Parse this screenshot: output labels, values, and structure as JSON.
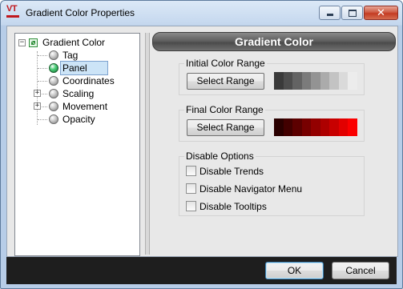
{
  "window": {
    "title": "Gradient Color Properties",
    "logo_text": "VT"
  },
  "tree": {
    "root": "Gradient Color",
    "items": [
      {
        "label": "Tag"
      },
      {
        "label": "Panel",
        "selected": true
      },
      {
        "label": "Coordinates"
      },
      {
        "label": "Scaling",
        "expandable": true
      },
      {
        "label": "Movement",
        "expandable": true
      },
      {
        "label": "Opacity"
      }
    ]
  },
  "header": {
    "title": "Gradient Color"
  },
  "initial_range": {
    "title": "Initial Color Range",
    "button": "Select Range",
    "colors": [
      "#3a3a3a",
      "#4d4d4d",
      "#636363",
      "#7b7b7b",
      "#939393",
      "#ababab",
      "#c3c3c3",
      "#dadada",
      "#ececec"
    ]
  },
  "final_range": {
    "title": "Final Color Range",
    "button": "Select Range",
    "colors": [
      "#2a0000",
      "#420000",
      "#5c0000",
      "#770000",
      "#930000",
      "#ad0000",
      "#c80000",
      "#e20000",
      "#fb0000"
    ]
  },
  "disable_options": {
    "title": "Disable Options",
    "items": [
      {
        "label": "Disable Trends",
        "checked": false
      },
      {
        "label": "Disable Navigator Menu",
        "checked": false
      },
      {
        "label": "Disable Tooltips",
        "checked": false
      }
    ]
  },
  "footer": {
    "ok": "OK",
    "cancel": "Cancel"
  }
}
